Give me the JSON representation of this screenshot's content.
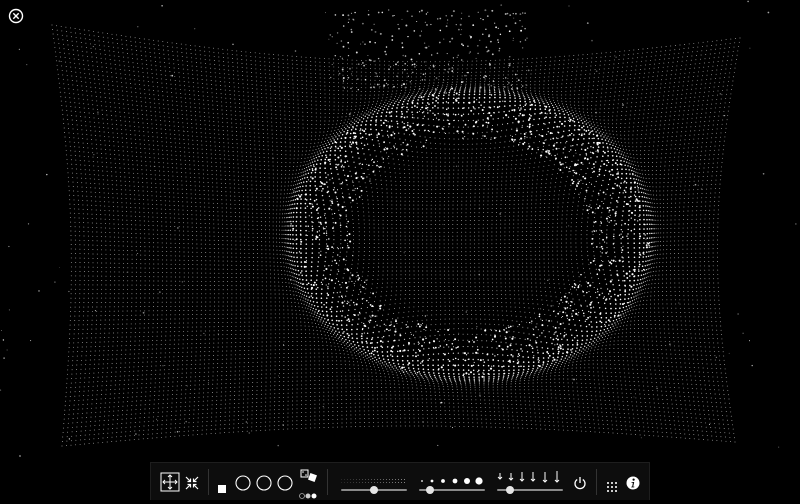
{
  "toolbar": {
    "groups": [
      {
        "id": "transform",
        "items": [
          "move-to-center-icon",
          "collapse-arrows-icon"
        ]
      },
      {
        "id": "shape",
        "items": [
          "square-shape-icon",
          "circle-shape-icon",
          "circle-shape-icon",
          "circle-shape-icon",
          "dice-random-icon",
          "dots-pattern-icon"
        ]
      },
      {
        "id": "sliders",
        "items": [
          "density-slider",
          "particle-size-slider",
          "gravity-slider"
        ]
      },
      {
        "id": "power",
        "items": [
          "power-icon"
        ]
      },
      {
        "id": "misc",
        "items": [
          "grid-icon",
          "info-icon"
        ]
      }
    ],
    "sliders": {
      "density": {
        "value": 0.5
      },
      "particle_size": {
        "value": 0.17
      },
      "gravity": {
        "value": 0.2
      }
    }
  },
  "colors": {
    "background": "#000000",
    "particle": "#ffffff",
    "toolbar_bg": "#0d0d0d",
    "separator": "#333333"
  }
}
